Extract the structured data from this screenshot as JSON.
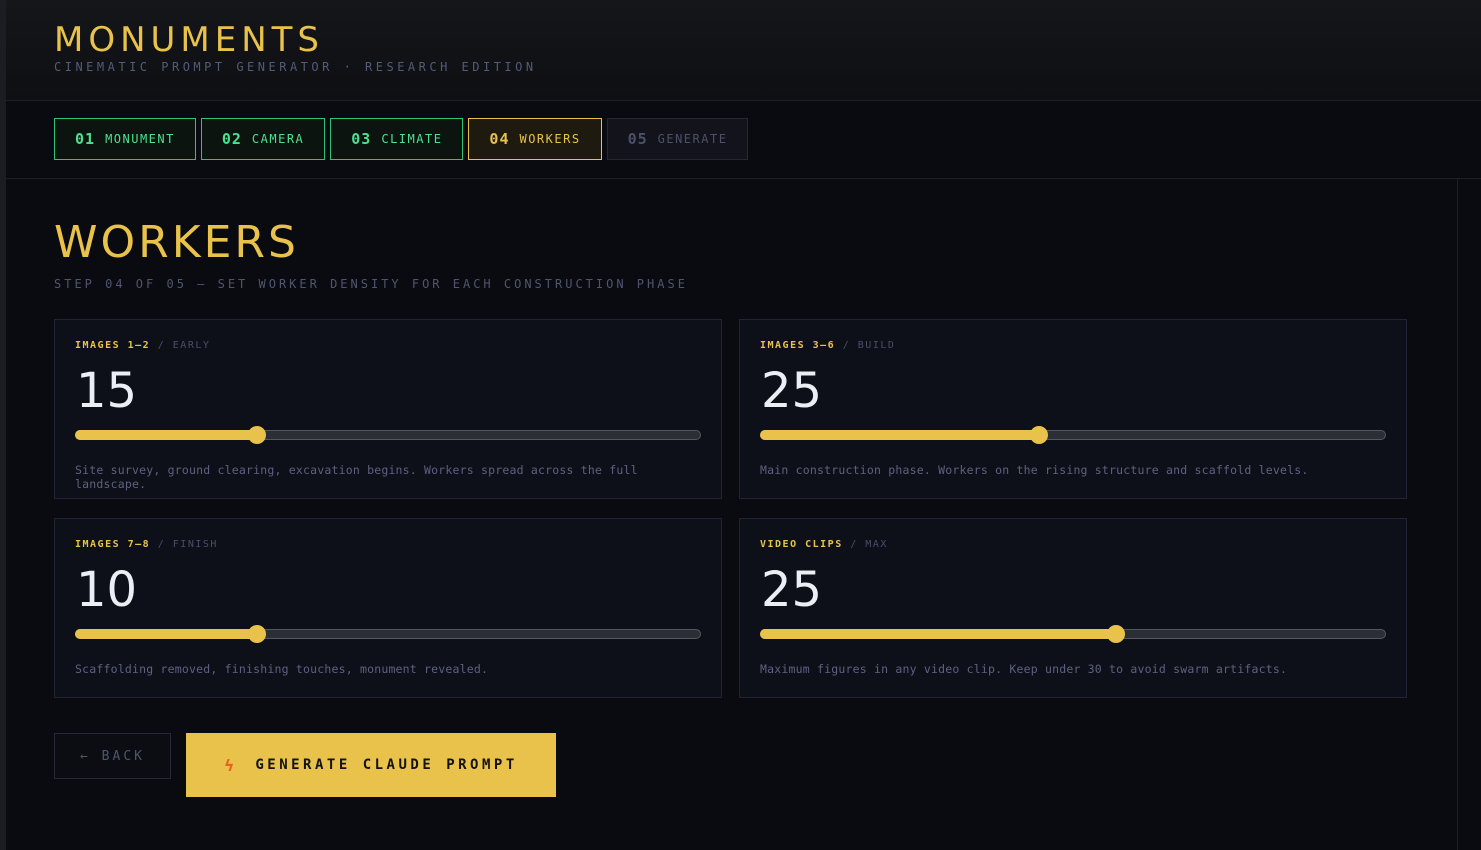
{
  "brand": {
    "title": "MONUMENTS",
    "subtitle": "CINEMATIC PROMPT GENERATOR · RESEARCH EDITION"
  },
  "steps": [
    {
      "num": "01",
      "label": "MONUMENT",
      "state": "done"
    },
    {
      "num": "02",
      "label": "CAMERA",
      "state": "done"
    },
    {
      "num": "03",
      "label": "CLIMATE",
      "state": "done"
    },
    {
      "num": "04",
      "label": "WORKERS",
      "state": "active"
    },
    {
      "num": "05",
      "label": "GENERATE",
      "state": "pending"
    }
  ],
  "page": {
    "title": "WORKERS",
    "subtitle": "STEP 04 OF 05 — SET WORKER DENSITY FOR EACH CONSTRUCTION PHASE"
  },
  "cards": [
    {
      "label": "IMAGES 1–2",
      "phase": "EARLY",
      "value": "15",
      "fill_fraction": 0.29,
      "description": "Site survey, ground clearing, excavation begins. Workers spread across the full landscape."
    },
    {
      "label": "IMAGES 3–6",
      "phase": "BUILD",
      "value": "25",
      "fill_fraction": 0.446,
      "description": "Main construction phase. Workers on the rising structure and scaffold levels."
    },
    {
      "label": "IMAGES 7–8",
      "phase": "FINISH",
      "value": "10",
      "fill_fraction": 0.29,
      "description": "Scaffolding removed, finishing touches, monument revealed."
    },
    {
      "label": "VIDEO CLIPS",
      "phase": "MAX",
      "value": "25",
      "fill_fraction": 0.569,
      "description": "Maximum figures in any video clip. Keep under 30 to avoid swarm artifacts."
    }
  ],
  "actions": {
    "back_label": "← BACK",
    "generate_label": "GENERATE CLAUDE PROMPT",
    "generate_icon": "bolt-icon"
  },
  "colors": {
    "accent": "#e8c24a",
    "done": "#4ee08f",
    "background": "#0a0b10",
    "bolt": "#e4661e"
  }
}
